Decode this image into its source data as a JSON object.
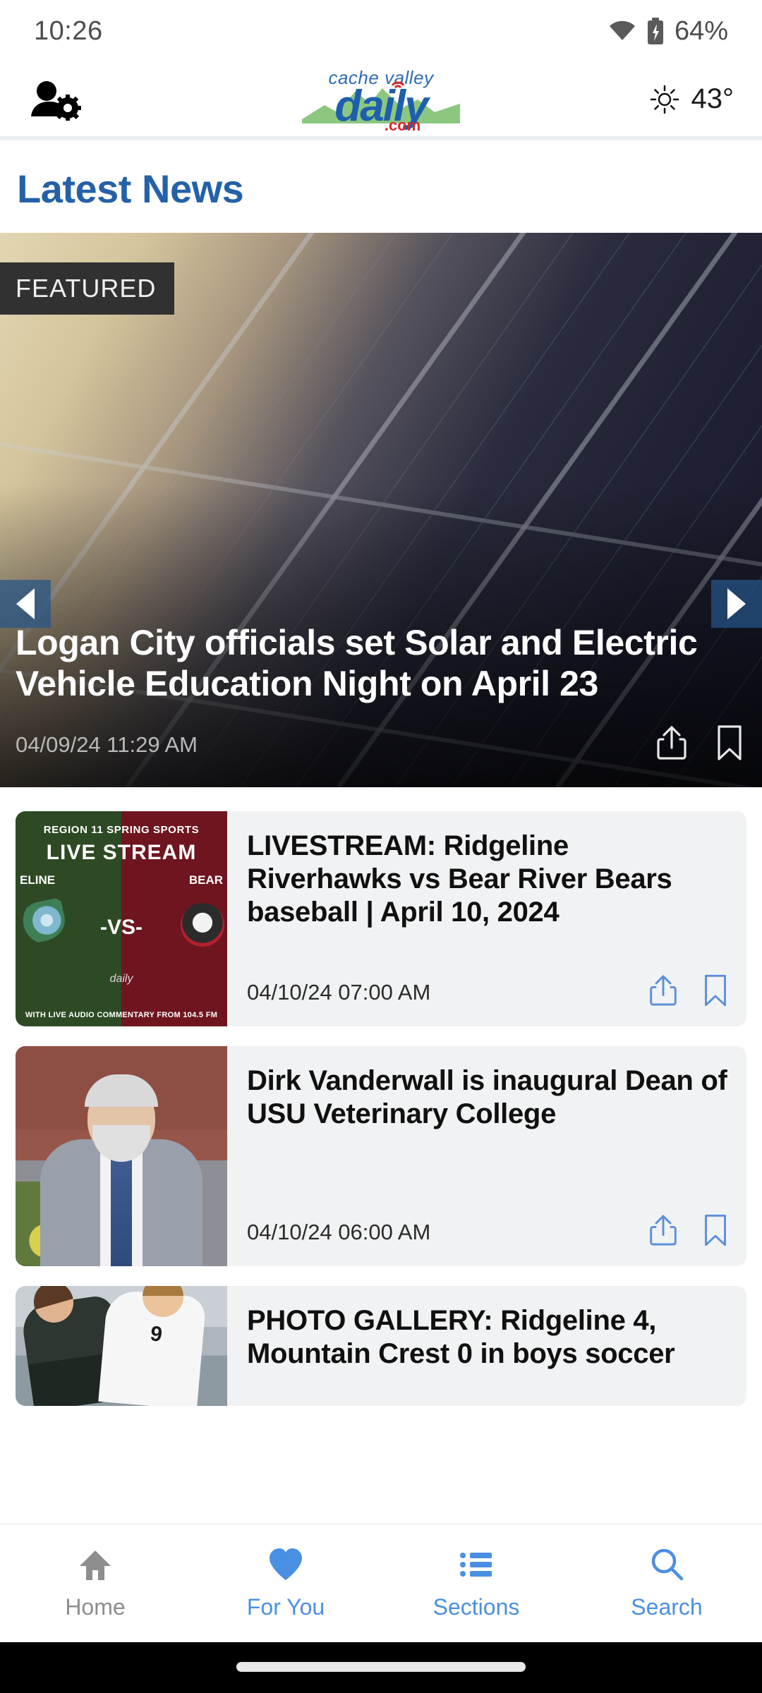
{
  "status_bar": {
    "time": "10:26",
    "battery_percent": "64%",
    "wifi_icon": "wifi-icon",
    "battery_icon": "battery-charging-icon"
  },
  "app_header": {
    "account_icon": "user-settings-icon",
    "logo": {
      "tagline": "cache valley",
      "name": "daily",
      "domain": ".com"
    },
    "weather": {
      "icon": "sun-icon",
      "temperature": "43°"
    }
  },
  "section": {
    "title": "Latest News"
  },
  "featured": {
    "badge": "FEATURED",
    "title": "Logan City officials set Solar and Electric Vehicle Education Night on April 23",
    "date": "04/09/24 11:29 AM",
    "prev_icon": "chevron-left-icon",
    "next_icon": "chevron-right-icon",
    "share_icon": "share-icon",
    "bookmark_icon": "bookmark-icon",
    "image_alt": "solar-panels-photo"
  },
  "articles": [
    {
      "title": "LIVESTREAM: Ridgeline Riverhawks vs Bear River Bears baseball | April 10, 2024",
      "date": "04/10/24 07:00 AM",
      "share_icon": "share-icon",
      "bookmark_icon": "bookmark-icon",
      "thumbnail": {
        "kind": "livestream-graphic",
        "region": "REGION 11 SPRING SPORTS",
        "headline": "LIVE STREAM",
        "team_left": "ELINE",
        "team_right": "BEAR",
        "vs": "-VS-",
        "logo": "daily",
        "footer": "WITH LIVE AUDIO COMMENTARY FROM 104.5 FM"
      }
    },
    {
      "title": "Dirk Vanderwall is inaugural Dean of USU Veterinary College",
      "date": "04/10/24 06:00 AM",
      "share_icon": "share-icon",
      "bookmark_icon": "bookmark-icon",
      "thumbnail": {
        "kind": "portrait-photo",
        "alt": "man-in-grey-suit-portrait"
      }
    },
    {
      "title": "PHOTO GALLERY: Ridgeline 4, Mountain Crest 0 in boys soccer",
      "date": "",
      "share_icon": "share-icon",
      "bookmark_icon": "bookmark-icon",
      "thumbnail": {
        "kind": "soccer-photo",
        "alt": "two-soccer-players-photo",
        "jersey_number": "9"
      }
    }
  ],
  "bottom_nav": [
    {
      "label": "Home",
      "icon": "home-icon",
      "active": false
    },
    {
      "label": "For You",
      "icon": "heart-icon",
      "active": true
    },
    {
      "label": "Sections",
      "icon": "list-icon",
      "active": true
    },
    {
      "label": "Search",
      "icon": "search-icon",
      "active": true
    }
  ],
  "colors": {
    "brand_blue": "#2461a8",
    "accent_blue": "#4a90e2",
    "logo_blue": "#1e5fad",
    "logo_red": "#d42a2a",
    "logo_green": "#8cc77f",
    "badge_dark": "#313131",
    "card_bg": "#f1f2f3"
  }
}
